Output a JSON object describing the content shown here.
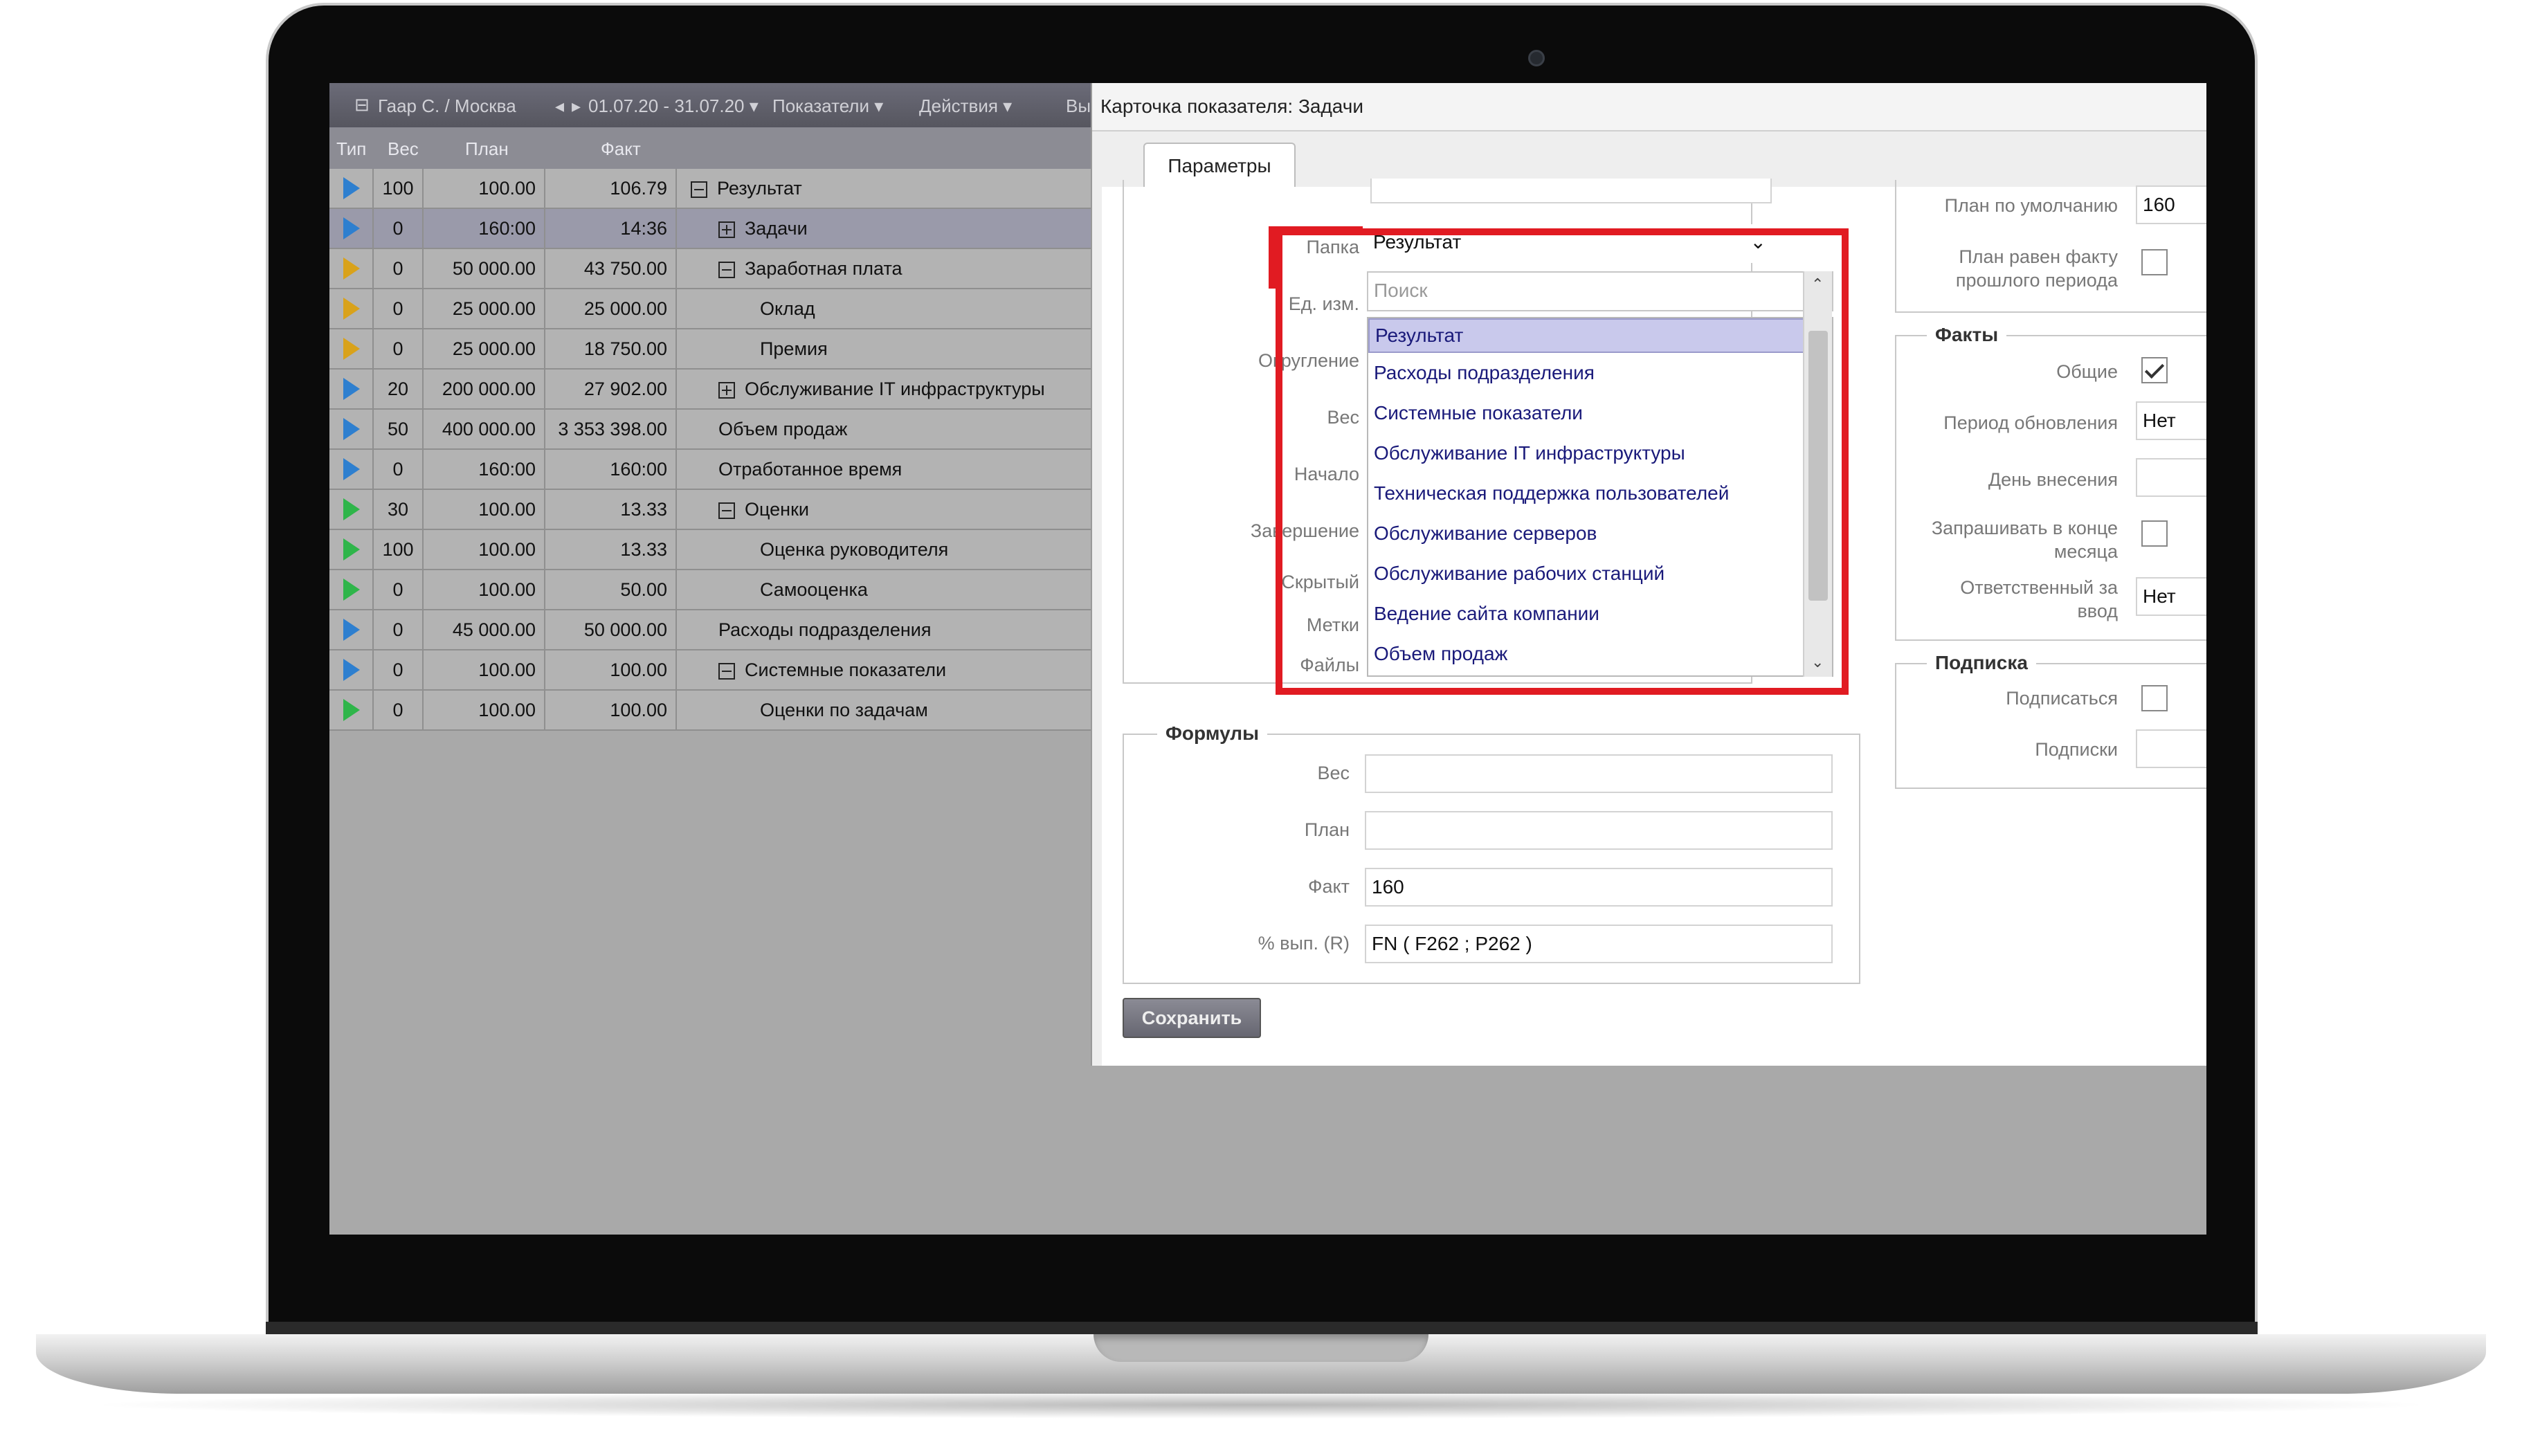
{
  "topbar": {
    "user": "Гаар С. / Москва",
    "period": "01.07.20 - 31.07.20",
    "indicators_menu": "Показатели",
    "actions_menu": "Действия",
    "truncated": "Вы"
  },
  "grid": {
    "headers": [
      "Тип",
      "Вес",
      "План",
      "Факт"
    ],
    "rows": [
      {
        "color": "blue",
        "weight": "100",
        "plan": "100.00",
        "fact": "106.79",
        "name": "Результат",
        "toggle": "minus",
        "indent": 0
      },
      {
        "color": "blue",
        "weight": "0",
        "plan": "160:00",
        "fact": "14:36",
        "name": "Задачи",
        "toggle": "plus",
        "indent": 1,
        "selected": true
      },
      {
        "color": "yellow",
        "weight": "0",
        "plan": "50 000.00",
        "fact": "43 750.00",
        "name": "Заработная плата",
        "toggle": "minus",
        "indent": 1
      },
      {
        "color": "yellow",
        "weight": "0",
        "plan": "25 000.00",
        "fact": "25 000.00",
        "name": "Оклад",
        "toggle": "",
        "indent": 2
      },
      {
        "color": "yellow",
        "weight": "0",
        "plan": "25 000.00",
        "fact": "18 750.00",
        "name": "Премия",
        "toggle": "",
        "indent": 2
      },
      {
        "color": "blue",
        "weight": "20",
        "plan": "200 000.00",
        "fact": "27 902.00",
        "name": "Обслуживание IT инфраструктуры",
        "toggle": "plus",
        "indent": 1
      },
      {
        "color": "blue",
        "weight": "50",
        "plan": "400 000.00",
        "fact": "3 353 398.00",
        "name": "Объем продаж",
        "toggle": "",
        "indent": 1
      },
      {
        "color": "blue",
        "weight": "0",
        "plan": "160:00",
        "fact": "160:00",
        "name": "Отработанное время",
        "toggle": "",
        "indent": 1
      },
      {
        "color": "green",
        "weight": "30",
        "plan": "100.00",
        "fact": "13.33",
        "name": "Оценки",
        "toggle": "minus",
        "indent": 1
      },
      {
        "color": "green",
        "weight": "100",
        "plan": "100.00",
        "fact": "13.33",
        "name": "Оценка руководителя",
        "toggle": "",
        "indent": 2
      },
      {
        "color": "green",
        "weight": "0",
        "plan": "100.00",
        "fact": "50.00",
        "name": "Самооценка",
        "toggle": "",
        "indent": 2
      },
      {
        "color": "blue",
        "weight": "0",
        "plan": "45 000.00",
        "fact": "50 000.00",
        "name": "Расходы подразделения",
        "toggle": "",
        "indent": 1
      },
      {
        "color": "blue",
        "weight": "0",
        "plan": "100.00",
        "fact": "100.00",
        "name": "Системные показатели",
        "toggle": "minus",
        "indent": 1
      },
      {
        "color": "green",
        "weight": "0",
        "plan": "100.00",
        "fact": "100.00",
        "name": "Оценки по задачам",
        "toggle": "",
        "indent": 2
      }
    ]
  },
  "dialog": {
    "title": "Карточка показателя: Задачи",
    "tab": "Параметры",
    "params": {
      "folder_label": "Папка",
      "folder_value": "Результат",
      "unit_label": "Ед. изм.",
      "rounding_label": "Округление",
      "weight_label": "Вес",
      "start_label": "Начало",
      "end_label": "Завершение",
      "hidden_label": "Скрытый",
      "tags_label": "Метки",
      "files_label": "Файлы"
    },
    "dropdown": {
      "search_placeholder": "Поиск",
      "items": [
        "Результат",
        "Расходы подразделения",
        "Системные показатели",
        "Обслуживание IT инфраструктуры",
        "Техническая поддержка пользователей",
        "Обслуживание серверов",
        "Обслуживание рабочих станций",
        "Ведение сайта компании",
        "Объем продаж"
      ],
      "highlighted_index": 0
    },
    "formulas": {
      "legend": "Формулы",
      "weight_label": "Вес",
      "weight_value": "",
      "plan_label": "План",
      "plan_value": "",
      "fact_label": "Факт",
      "fact_value": "160",
      "pct_label": "% вып. (R)",
      "pct_value": "FN ( F262 ; P262 )"
    },
    "save_button": "Сохранить",
    "right": {
      "default_plan_label": "План по умолчанию",
      "default_plan_value": "160",
      "plan_eq_fact_label_1": "План равен факту",
      "plan_eq_fact_label_2": "прошлого периода",
      "facts_legend": "Факты",
      "common_label": "Общие",
      "common_checked": true,
      "update_period_label": "Период обновления",
      "update_period_value": "Нет",
      "entry_day_label": "День внесения",
      "ask_month_end_label_1": "Запрашивать в конце",
      "ask_month_end_label_2": "месяца",
      "responsible_label_1": "Ответственный за",
      "responsible_label_2": "ввод",
      "responsible_value": "Нет",
      "subscription_legend": "Подписка",
      "subscribe_label": "Подписаться",
      "subscriptions_label": "Подписки"
    }
  },
  "colors": {
    "blue": "#2e7fcf",
    "yellow": "#d9a21b",
    "green": "#2fb54a",
    "highlight": "#e11b22"
  }
}
